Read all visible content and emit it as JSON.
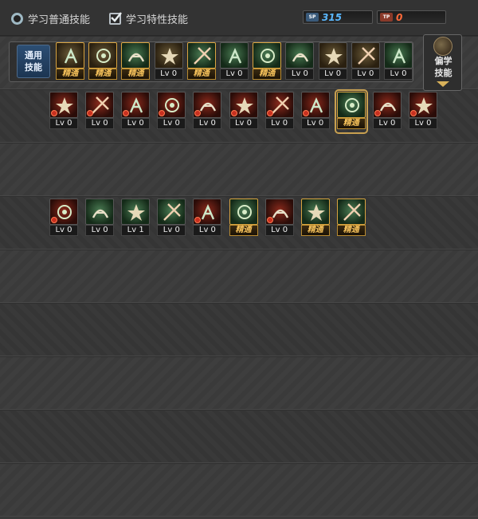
{
  "top": {
    "opt_normal": "学习普通技能",
    "opt_special": "学习特性技能",
    "sp_icon": "SP",
    "sp_value": "315",
    "tp_icon": "TP",
    "tp_value": "0"
  },
  "general": {
    "label": "通用\n技能",
    "skills": [
      {
        "level": "精通",
        "type": "gold",
        "icon": "gear-icon"
      },
      {
        "level": "精通",
        "type": "gold",
        "icon": "gear-icon"
      },
      {
        "level": "精通",
        "type": "green",
        "icon": "gear-icon"
      },
      {
        "level": "Lv 0",
        "type": "gold",
        "icon": "gear-icon"
      },
      {
        "level": "精通",
        "type": "green",
        "icon": "gear-icon"
      },
      {
        "level": "Lv 0",
        "type": "green",
        "icon": "gear-icon"
      },
      {
        "level": "精通",
        "type": "green",
        "icon": "gear-icon"
      },
      {
        "level": "Lv 0",
        "type": "green",
        "icon": "gear-icon"
      },
      {
        "level": "Lv 0",
        "type": "gold",
        "icon": "gear-icon"
      },
      {
        "level": "Lv 0",
        "type": "gold",
        "icon": "gear-icon"
      },
      {
        "level": "Lv 0",
        "type": "green",
        "icon": "gear-icon"
      }
    ]
  },
  "side": {
    "label": "偏学\n技能"
  },
  "row1": [
    {
      "level": "Lv 0",
      "type": "red"
    },
    {
      "level": "Lv 0",
      "type": "red"
    },
    {
      "level": "Lv 0",
      "type": "red"
    },
    {
      "level": "Lv 0",
      "type": "red"
    },
    {
      "level": "Lv 0",
      "type": "red"
    },
    {
      "level": "Lv 0",
      "type": "red"
    },
    {
      "level": "Lv 0",
      "type": "red"
    },
    {
      "level": "Lv 0",
      "type": "red"
    },
    {
      "level": "精通",
      "type": "green"
    },
    {
      "level": "Lv 0",
      "type": "red"
    },
    {
      "level": "Lv 0",
      "type": "red"
    }
  ],
  "row2": [
    {
      "level": "Lv 0",
      "type": "red"
    },
    {
      "level": "Lv 0",
      "type": "green"
    },
    {
      "level": "Lv 1",
      "type": "green"
    },
    {
      "level": "Lv 0",
      "type": "green"
    },
    {
      "level": "Lv 0",
      "type": "red"
    },
    {
      "level": "精通",
      "type": "green"
    },
    {
      "level": "Lv 0",
      "type": "red"
    },
    {
      "level": "精通",
      "type": "green"
    },
    {
      "level": "精通",
      "type": "green"
    }
  ]
}
